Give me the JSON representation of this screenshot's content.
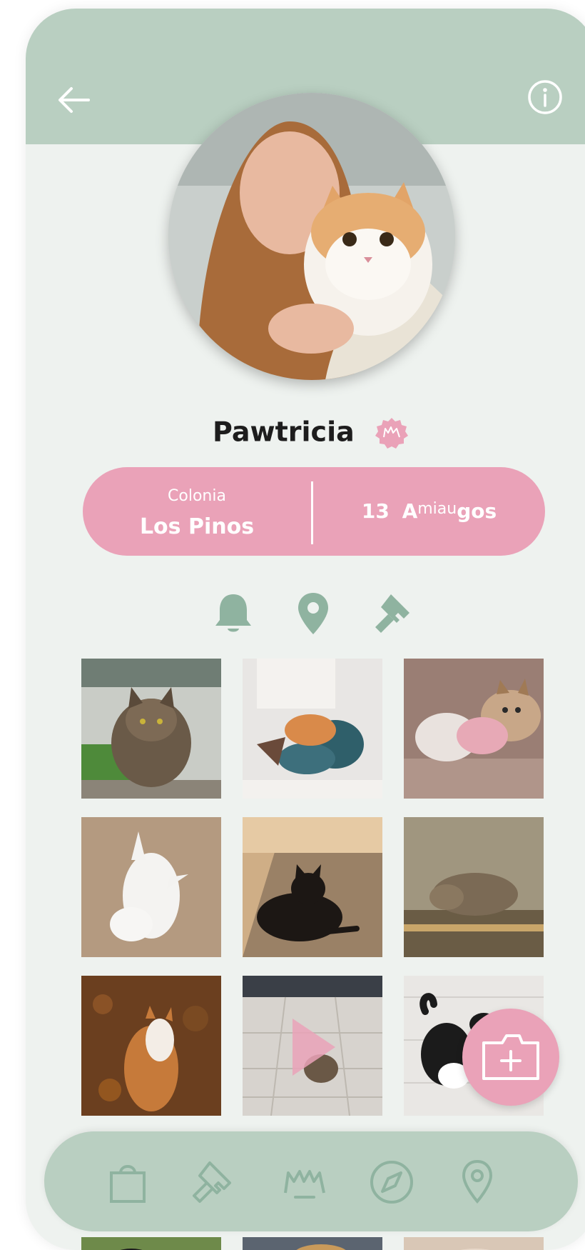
{
  "profile": {
    "name": "Pawtricia",
    "colonia_label": "Colonia",
    "colonia_value": "Los Pinos",
    "friends_count": "13",
    "friends_label_pre": "A",
    "friends_label_mid": "miau",
    "friends_label_post": "gos"
  },
  "icons": {
    "back": "arrow-left-icon",
    "info": "info-icon",
    "badge": "cat-face-badge-icon",
    "quick_actions": [
      "bell-icon",
      "map-pin-icon",
      "hammer-icon"
    ],
    "fab": "add-photo-icon",
    "nav": [
      "shopping-bag-icon",
      "hammer-icon",
      "cats-icon",
      "compass-icon",
      "map-pin-icon"
    ]
  },
  "gallery": {
    "items": [
      {
        "subject": "tabby-cat-on-wall"
      },
      {
        "subject": "orange-kitten-in-lap"
      },
      {
        "subject": "two-calico-cats"
      },
      {
        "subject": "white-cat-rolling"
      },
      {
        "subject": "black-cat-on-street"
      },
      {
        "subject": "tabby-cat-sleeping"
      },
      {
        "subject": "orange-cat-in-leaves"
      },
      {
        "subject": "cat-video-in-street",
        "is_video": true
      },
      {
        "subject": "tuxedo-cat-on-stairs"
      }
    ]
  },
  "colors": {
    "header": "#b9cfc1",
    "accent_pink": "#eaa2b8",
    "background": "#eef2ef",
    "icon_green": "#8fb3a0"
  }
}
